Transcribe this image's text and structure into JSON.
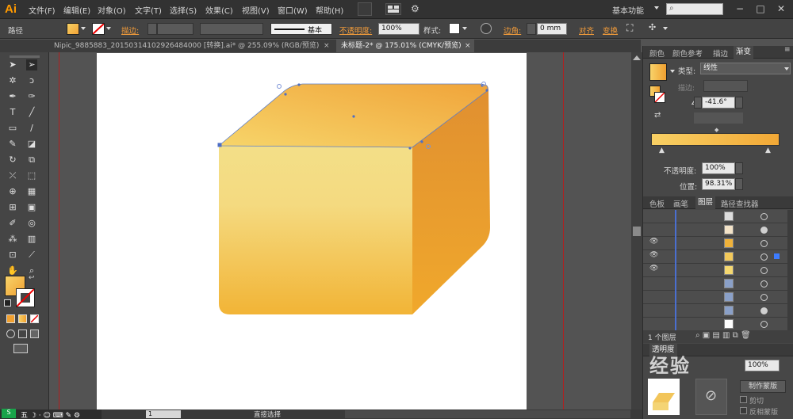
{
  "menu": {
    "logo": "Ai",
    "items": [
      "文件(F)",
      "编辑(E)",
      "对象(O)",
      "文字(T)",
      "选择(S)",
      "效果(C)",
      "视图(V)",
      "窗口(W)",
      "帮助(H)"
    ],
    "workspace": "基本功能",
    "window_controls": [
      "−",
      "□",
      "✕"
    ]
  },
  "control_bar": {
    "path_label": "路径",
    "stroke_label": "描边:",
    "stroke_style": "基本",
    "opacity_label": "不透明度:",
    "opacity_value": "100%",
    "style_label": "样式:",
    "corner_label": "边角:",
    "corner_value": "0 mm",
    "align_label": "对齐",
    "transform_label": "变换"
  },
  "tabs": [
    {
      "label": "Nipic_9885883_20150314102926484000 [转换].ai* @ 255.09% (RGB/预览)",
      "active": false
    },
    {
      "label": "未标题-2* @ 175.01% (CMYK/预览)",
      "active": true
    }
  ],
  "gradient_panel": {
    "tabs": [
      "颜色",
      "颜色参考",
      "描边",
      "渐变"
    ],
    "type_label": "类型:",
    "type_value": "线性",
    "stroke_label": "描边:",
    "angle_value": "-41.6°",
    "opacity_label": "不透明度:",
    "opacity_value": "100%",
    "location_label": "位置:",
    "location_value": "98.31%"
  },
  "layers_panel": {
    "tabs": [
      "色板",
      "画笔",
      "图层",
      "路径查找器"
    ],
    "footer_count": "1 个图层"
  },
  "transparency_panel": {
    "tabs": [
      "透明度"
    ],
    "opacity_value": "100%",
    "make_mask": "制作蒙版",
    "clip": "剪切",
    "invert_mask": "反相蒙版"
  },
  "status": {
    "zoom": "175%",
    "page": "1",
    "tool_name": "直接选择"
  },
  "watermark": "经验"
}
